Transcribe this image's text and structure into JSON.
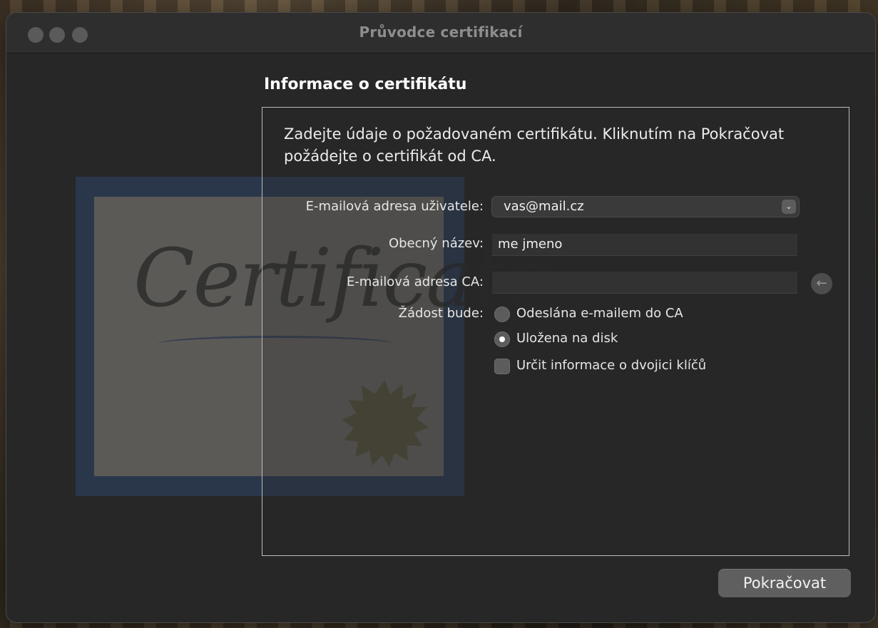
{
  "window": {
    "title": "Průvodce certifikací"
  },
  "illustration": {
    "word": "Certificate"
  },
  "page": {
    "section_title": "Informace o certifikátu",
    "intro": "Zadejte údaje o požadovaném certifikátu. Kliknutím na Pokračovat požádejte o certifikát od CA."
  },
  "form": {
    "user_email": {
      "label": "E-mailová adresa uživatele:",
      "value": "vas@mail.cz"
    },
    "common_name": {
      "label": "Obecný název:",
      "value": "me jmeno"
    },
    "ca_email": {
      "label": "E-mailová adresa CA:",
      "value": ""
    },
    "request": {
      "label": "Žádost bude:",
      "options": [
        {
          "label": "Odeslána e-mailem do CA",
          "checked": false
        },
        {
          "label": "Uložena na disk",
          "checked": true
        }
      ]
    },
    "key_pair": {
      "label": "Určit informace o dvojici klíčů",
      "checked": false
    }
  },
  "footer": {
    "continue_label": "Pokračovat"
  },
  "icons": {
    "back": "arrow-left-icon",
    "select": "chevron-down-icon"
  }
}
